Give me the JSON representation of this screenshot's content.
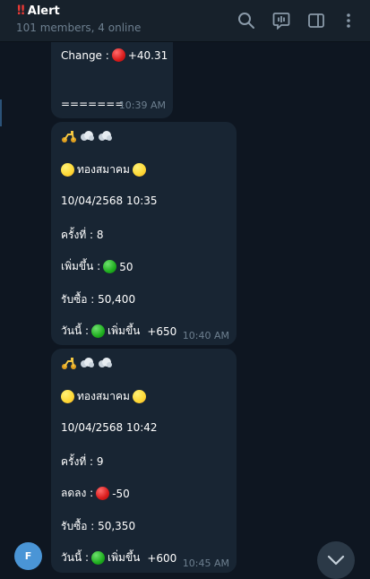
{
  "header": {
    "title_icon": "!!",
    "title": "Alert",
    "subtitle": "101 members, 4 online",
    "icons": [
      "search-icon",
      "live-stream-icon",
      "sidebar-toggle-icon",
      "more-icon"
    ]
  },
  "messages": [
    {
      "change_label": "Change :",
      "change_value": "+40.31",
      "separator": "=======",
      "time": "10:39 AM"
    },
    {
      "emoji": [
        "scooter",
        "dash",
        "dash"
      ],
      "name": "ทองสมาคม",
      "datetime": "10/04/2568  10:35",
      "round_label": "ครั้งที่ : 8",
      "direction_label": "เพิ่มขึ้น :",
      "direction_value": "50",
      "buy_label": "รับซื้อ : 50,400",
      "today_label": "วันนี้ :",
      "today_direction": "เพิ่มขึ้น",
      "today_value": "+650",
      "time": "10:40 AM"
    },
    {
      "emoji": [
        "scooter",
        "dash",
        "dash"
      ],
      "name": "ทองสมาคม",
      "datetime": "10/04/2568  10:42",
      "round_label": "ครั้งที่ : 9",
      "direction_label": "ลดลง :",
      "direction_value": "-50",
      "buy_label": "รับซื้อ : 50,350",
      "today_label": "วันนี้ :",
      "today_direction": "เพิ่มขึ้น",
      "today_value": "+600",
      "time": "10:45 AM"
    }
  ],
  "avatar": {
    "initial": "F",
    "color": "#4a95d6"
  },
  "colors": {
    "background": "#0e1621",
    "bubble": "#182533",
    "header": "#17212b",
    "meta": "#6d7f8f"
  }
}
